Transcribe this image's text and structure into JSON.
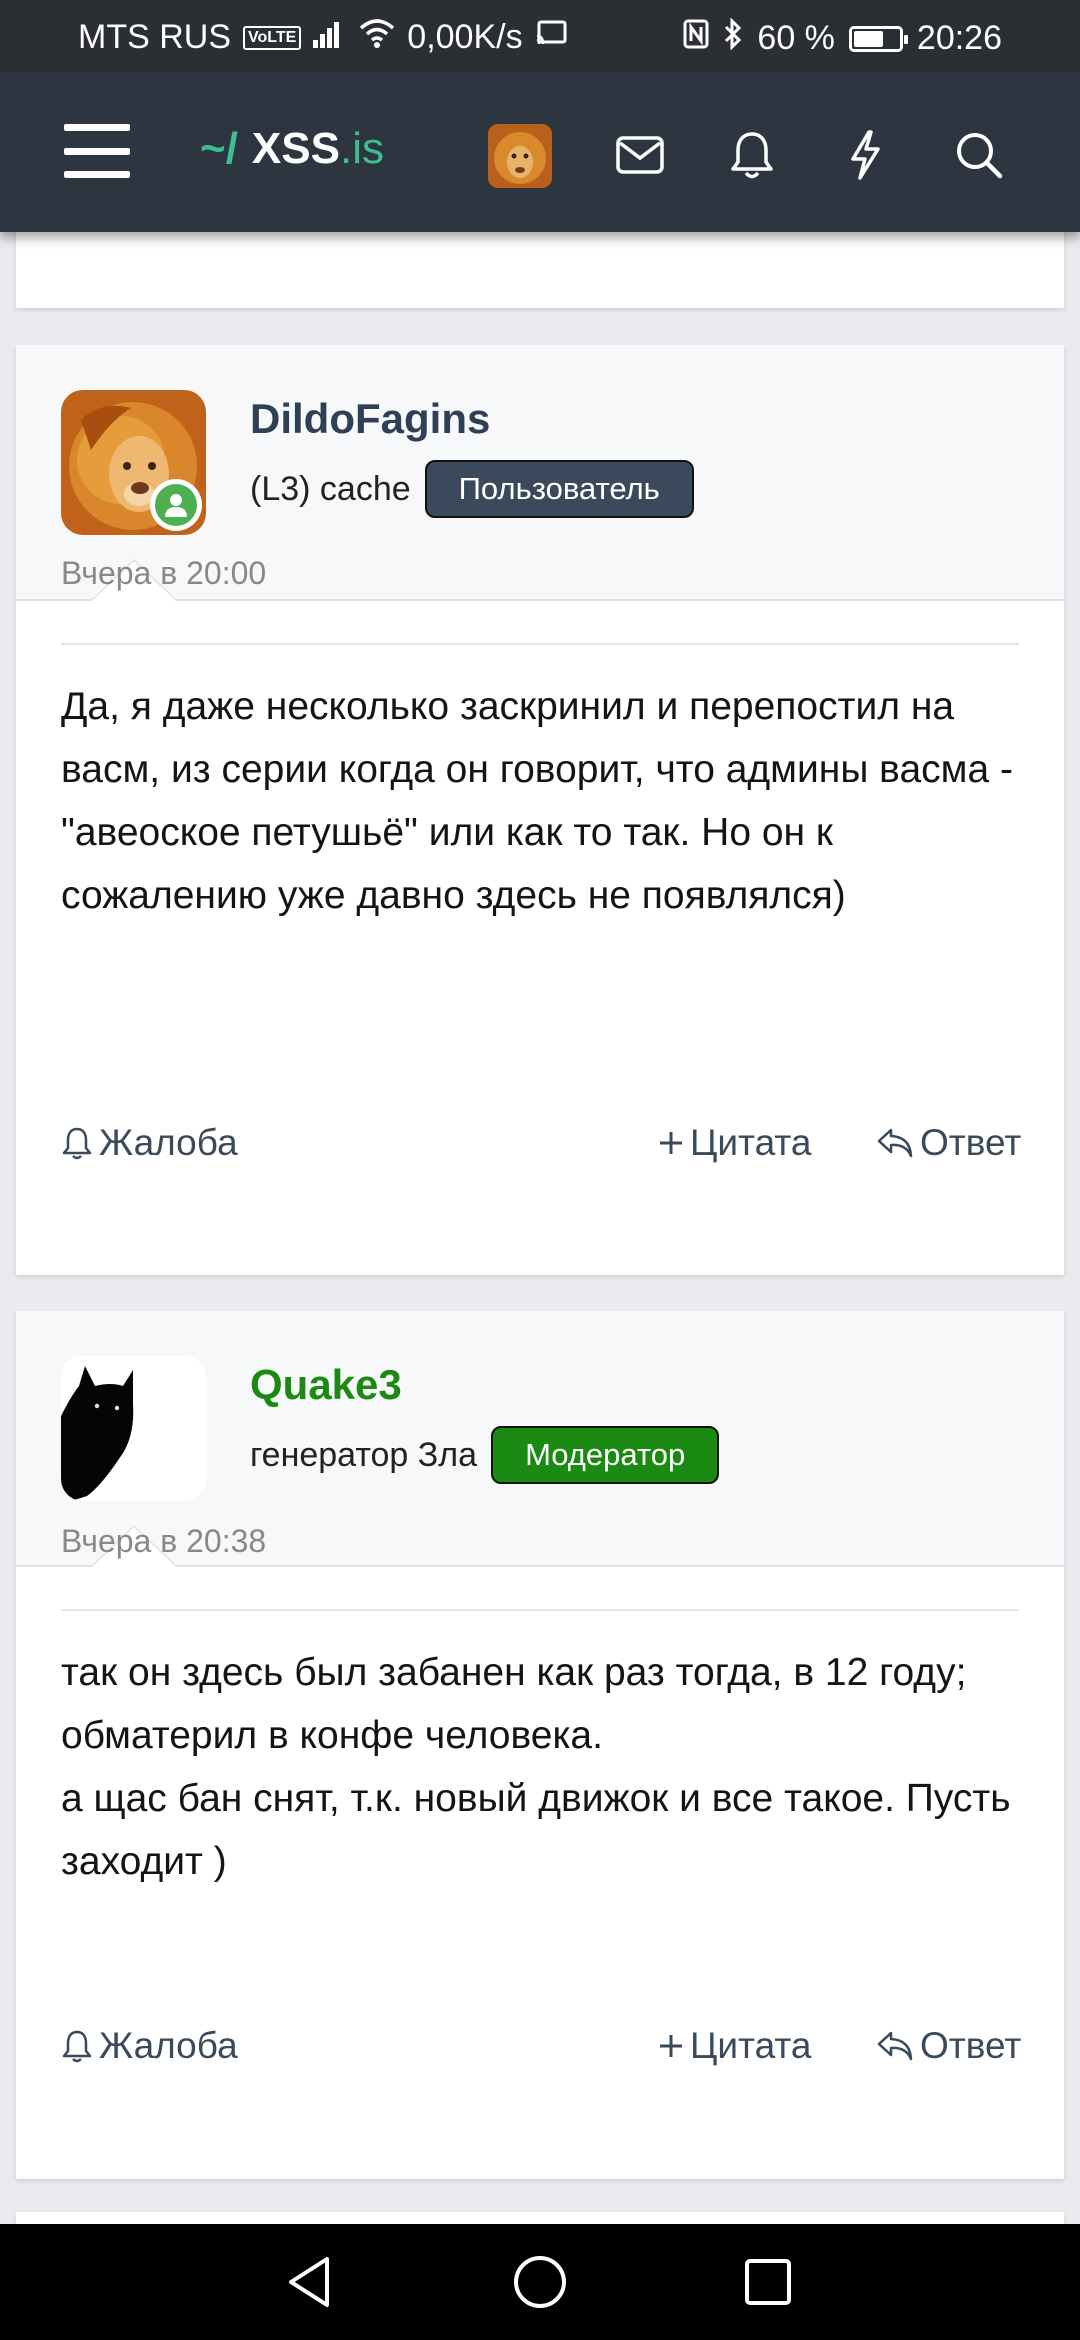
{
  "status_bar": {
    "carrier": "MTS RUS",
    "volte": "VoLTE",
    "speed": "0,00K/s",
    "battery": "60 %",
    "battery_level": 0.6,
    "time": "20:26"
  },
  "header": {
    "logo_prefix": "~/",
    "logo_main": "XSS",
    "logo_tld": ".is"
  },
  "posts": [
    {
      "username": "DildoFagins",
      "username_color": "#2f3f55",
      "user_title": "(L3) cache",
      "badge": "Пользователь",
      "badge_color": "#3a4a5c",
      "time": "Вчера в 20:00",
      "body": [
        "Да, я даже несколько заскринил и перепостил на васм, из серии когда он говорит, что админы васма - \"авеоское петушьё\" или как то так. Но он к сожалению уже давно здесь не появлялся)"
      ],
      "actions": {
        "report": "Жалоба",
        "quote": "Цитата",
        "reply": "Ответ"
      }
    },
    {
      "username": "Quake3",
      "username_color": "#1a8a12",
      "user_title": "генератор Зла",
      "badge": "Модератор",
      "badge_color": "#1a8a12",
      "time": "Вчера в 20:38",
      "body": [
        "так он здесь был забанен как раз тогда, в 12 году; обматерил в конфе человека.",
        "а щас бан снят, т.к. новый движок и все такое. Пусть заходит )"
      ],
      "actions": {
        "report": "Жалоба",
        "quote": "Цитата",
        "reply": "Ответ"
      }
    }
  ],
  "icons": {
    "menu": "hamburger-icon",
    "inbox": "envelope-icon",
    "alerts": "bell-icon",
    "whats_new": "lightning-icon",
    "search": "search-icon"
  }
}
